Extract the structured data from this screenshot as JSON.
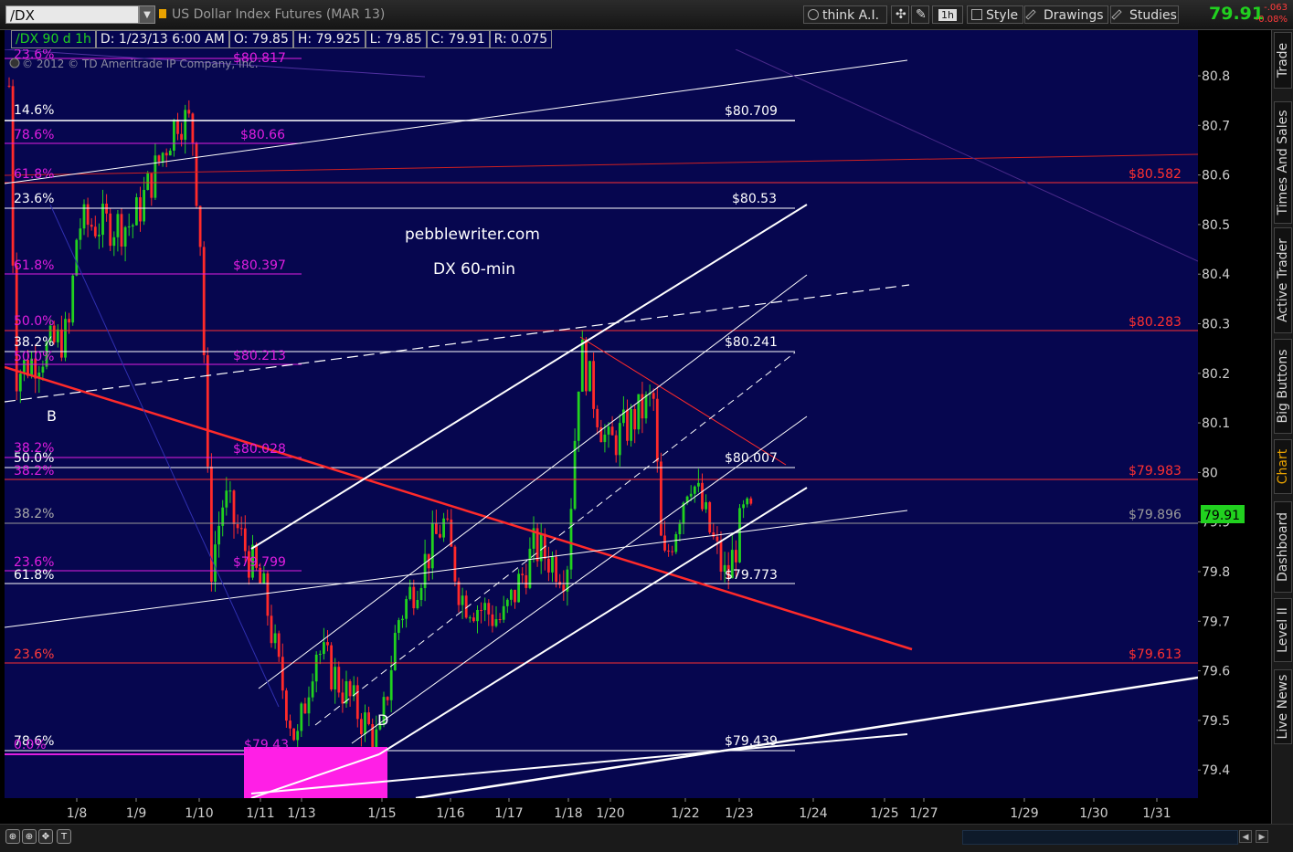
{
  "toolbar": {
    "symbol": "/DX",
    "description": "US Dollar Index Futures (MAR 13)",
    "think_ai": "think A.I.",
    "timeframe": "1h",
    "style": "Style",
    "drawings": "Drawings",
    "studies": "Studies",
    "last": "79.91",
    "change": "-.063",
    "change_pct": "-0.08%"
  },
  "infobar": {
    "symbol_period": "/DX 90 d 1h",
    "date": "D: 1/23/13 6:00 AM",
    "open": "O: 79.85",
    "high": "H: 79.925",
    "low": "L: 79.85",
    "close": "C: 79.91",
    "range": "R: 0.075"
  },
  "copyright": "© 2012 © TD Ameritrade IP Company, Inc.",
  "watermark": {
    "site": "pebblewriter.com",
    "label": "DX 60-min"
  },
  "price_axis": {
    "ticks": [
      "80.8",
      "80.7",
      "80.6",
      "80.5",
      "80.4",
      "80.3",
      "80.2",
      "80.1",
      "80",
      "79.9",
      "79.8",
      "79.7",
      "79.6",
      "79.5",
      "79.4"
    ],
    "current_price": "79.91",
    "red_labels": [
      "$80.582",
      "$80.283",
      "$79.983",
      "$79.613"
    ],
    "gray_label": "$79.896"
  },
  "time_axis": {
    "ticks": [
      "1/8",
      "1/9",
      "1/10",
      "1/11",
      "1/13",
      "1/15",
      "1/16",
      "1/17",
      "1/18",
      "1/20",
      "1/22",
      "1/23",
      "1/24",
      "1/25",
      "1/27",
      "1/29",
      "1/30",
      "1/31"
    ]
  },
  "levels": {
    "white_labels": [
      "$80.709",
      "$80.53",
      "$80.241",
      "$80.007",
      "$79.773",
      "$79.439"
    ],
    "magenta_labels": [
      "$80.817",
      "$80.66",
      "$80.397",
      "$80.213",
      "$80.028",
      "$79.799",
      "$79.43"
    ],
    "white_pcts": [
      "14.6%",
      "23.6%",
      "38.2%",
      "50.0%",
      "38.2%",
      "61.8%",
      "78.6%"
    ],
    "magenta_pcts": [
      "23.6%",
      "78.6%",
      "61.8%",
      "61.8%",
      "50.0%",
      "50.0%",
      "38.2%",
      "38.2%",
      "23.6%",
      "0.0%"
    ],
    "red_pcts": [
      "23.6%"
    ]
  },
  "wave_labels": [
    "B",
    "D"
  ],
  "sidebar": [
    "Trade",
    "Times And Sales",
    "Active Trader",
    "Big Buttons",
    "Chart",
    "Dashboard",
    "Level II",
    "Live News"
  ],
  "sidebar_active": "Chart",
  "colors": {
    "chart_bg": "#06064f",
    "up": "#21d11f",
    "down": "#ff2a2a",
    "magenta": "#e01ee0",
    "fib_red": "#ff3030",
    "white": "#ffffff"
  },
  "chart_data": {
    "type": "candlestick",
    "title": "DX 60-min",
    "ylim": [
      79.35,
      80.87
    ],
    "x_ticks": [
      "1/8",
      "1/9",
      "1/10",
      "1/11",
      "1/13",
      "1/15",
      "1/16",
      "1/17",
      "1/18",
      "1/20",
      "1/22",
      "1/23",
      "1/24",
      "1/25",
      "1/27",
      "1/29",
      "1/30",
      "1/31"
    ],
    "close_path": [
      {
        "x": "1/7",
        "y": 80.78
      },
      {
        "x": "1/7",
        "y": 80.2
      },
      {
        "x": "1/8",
        "y": 80.28
      },
      {
        "x": "1/8",
        "y": 80.5
      },
      {
        "x": "1/9",
        "y": 80.5
      },
      {
        "x": "1/9",
        "y": 80.72
      },
      {
        "x": "1/10",
        "y": 80.7
      },
      {
        "x": "1/10",
        "y": 80.45
      },
      {
        "x": "1/10",
        "y": 79.8
      },
      {
        "x": "1/11",
        "y": 79.95
      },
      {
        "x": "1/11",
        "y": 79.75
      },
      {
        "x": "1/11",
        "y": 79.6
      },
      {
        "x": "1/13",
        "y": 79.45
      },
      {
        "x": "1/13",
        "y": 79.65
      },
      {
        "x": "1/15",
        "y": 79.45
      },
      {
        "x": "1/15",
        "y": 79.7
      },
      {
        "x": "1/16",
        "y": 79.9
      },
      {
        "x": "1/16",
        "y": 79.75
      },
      {
        "x": "1/17",
        "y": 79.7
      },
      {
        "x": "1/17",
        "y": 79.85
      },
      {
        "x": "1/18",
        "y": 79.8
      },
      {
        "x": "1/18",
        "y": 80.25
      },
      {
        "x": "1/20",
        "y": 80.05
      },
      {
        "x": "1/20",
        "y": 80.15
      },
      {
        "x": "1/22",
        "y": 79.8
      },
      {
        "x": "1/22",
        "y": 80.0
      },
      {
        "x": "1/23",
        "y": 79.78
      },
      {
        "x": "1/23",
        "y": 79.91
      }
    ]
  }
}
